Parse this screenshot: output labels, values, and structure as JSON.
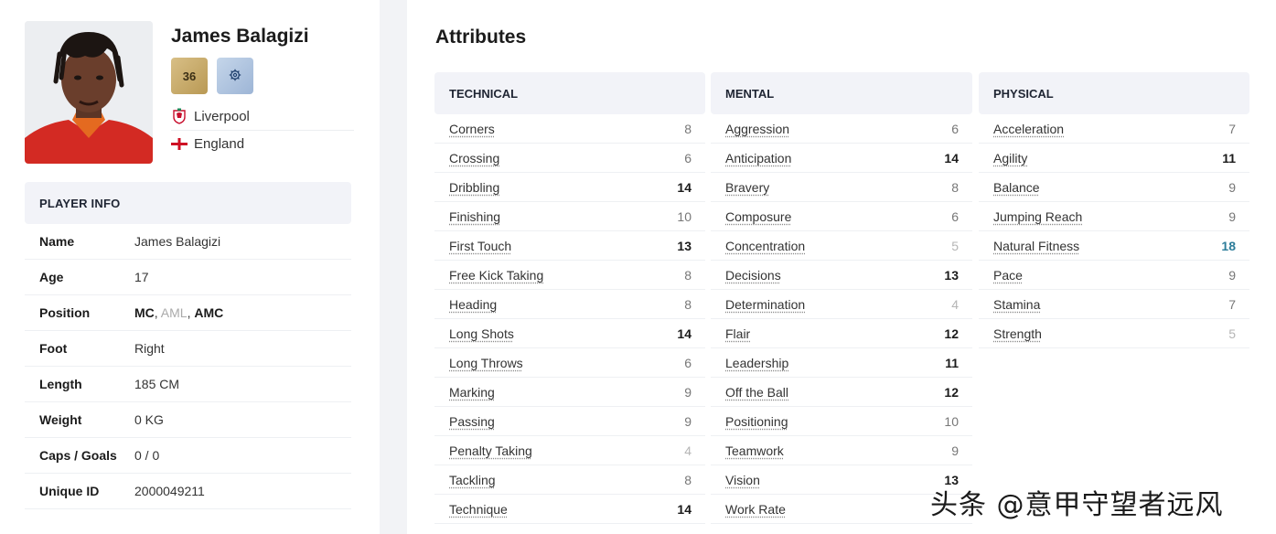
{
  "player": {
    "name": "James Balagizi",
    "ability": "36",
    "role_icon": "settings-gear-icon",
    "club": "Liverpool",
    "club_icon": "liverpool-crest-icon",
    "nation": "England",
    "nation_icon": "england-flag-icon"
  },
  "info": {
    "header": "PLAYER INFO",
    "rows": [
      {
        "label": "Name",
        "value": "James Balagizi"
      },
      {
        "label": "Age",
        "value": "17"
      },
      {
        "label": "Position",
        "positions": [
          {
            "text": "MC",
            "style": "main"
          },
          {
            "text": ", ",
            "style": "sep"
          },
          {
            "text": "AML",
            "style": "minor"
          },
          {
            "text": ", ",
            "style": "sep"
          },
          {
            "text": "AMC",
            "style": "main"
          }
        ]
      },
      {
        "label": "Foot",
        "value": "Right"
      },
      {
        "label": "Length",
        "value": "185 CM"
      },
      {
        "label": "Weight",
        "value": "0 KG"
      },
      {
        "label": "Caps / Goals",
        "value": "0 / 0"
      },
      {
        "label": "Unique ID",
        "value": "2000049211"
      }
    ]
  },
  "attributes": {
    "title": "Attributes",
    "columns": [
      {
        "header": "TECHNICAL",
        "items": [
          {
            "name": "Corners",
            "value": "8",
            "level": "mid"
          },
          {
            "name": "Crossing",
            "value": "6",
            "level": "mid"
          },
          {
            "name": "Dribbling",
            "value": "14",
            "level": "high"
          },
          {
            "name": "Finishing",
            "value": "10",
            "level": "mid"
          },
          {
            "name": "First Touch",
            "value": "13",
            "level": "high"
          },
          {
            "name": "Free Kick Taking",
            "value": "8",
            "level": "mid"
          },
          {
            "name": "Heading",
            "value": "8",
            "level": "mid"
          },
          {
            "name": "Long Shots",
            "value": "14",
            "level": "high"
          },
          {
            "name": "Long Throws",
            "value": "6",
            "level": "mid"
          },
          {
            "name": "Marking",
            "value": "9",
            "level": "mid"
          },
          {
            "name": "Passing",
            "value": "9",
            "level": "mid"
          },
          {
            "name": "Penalty Taking",
            "value": "4",
            "level": "low"
          },
          {
            "name": "Tackling",
            "value": "8",
            "level": "mid"
          },
          {
            "name": "Technique",
            "value": "14",
            "level": "high"
          }
        ]
      },
      {
        "header": "MENTAL",
        "items": [
          {
            "name": "Aggression",
            "value": "6",
            "level": "mid"
          },
          {
            "name": "Anticipation",
            "value": "14",
            "level": "high"
          },
          {
            "name": "Bravery",
            "value": "8",
            "level": "mid"
          },
          {
            "name": "Composure",
            "value": "6",
            "level": "mid"
          },
          {
            "name": "Concentration",
            "value": "5",
            "level": "low"
          },
          {
            "name": "Decisions",
            "value": "13",
            "level": "high"
          },
          {
            "name": "Determination",
            "value": "4",
            "level": "low"
          },
          {
            "name": "Flair",
            "value": "12",
            "level": "high"
          },
          {
            "name": "Leadership",
            "value": "11",
            "level": "high"
          },
          {
            "name": "Off the Ball",
            "value": "12",
            "level": "high"
          },
          {
            "name": "Positioning",
            "value": "10",
            "level": "mid"
          },
          {
            "name": "Teamwork",
            "value": "9",
            "level": "mid"
          },
          {
            "name": "Vision",
            "value": "13",
            "level": "high"
          },
          {
            "name": "Work Rate",
            "value": "",
            "level": "mid"
          }
        ]
      },
      {
        "header": "PHYSICAL",
        "items": [
          {
            "name": "Acceleration",
            "value": "7",
            "level": "mid"
          },
          {
            "name": "Agility",
            "value": "11",
            "level": "high"
          },
          {
            "name": "Balance",
            "value": "9",
            "level": "mid"
          },
          {
            "name": "Jumping Reach",
            "value": "9",
            "level": "mid"
          },
          {
            "name": "Natural Fitness",
            "value": "18",
            "level": "top"
          },
          {
            "name": "Pace",
            "value": "9",
            "level": "mid"
          },
          {
            "name": "Stamina",
            "value": "7",
            "level": "mid"
          },
          {
            "name": "Strength",
            "value": "5",
            "level": "low"
          }
        ]
      }
    ]
  },
  "watermark": "头条 @意甲守望者远风"
}
